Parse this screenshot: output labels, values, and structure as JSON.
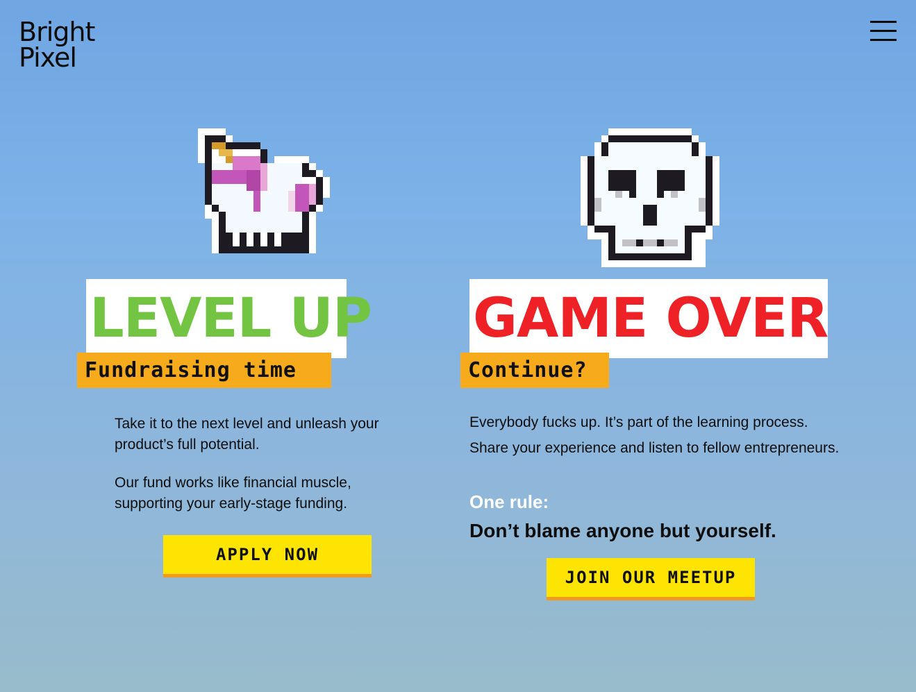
{
  "header": {
    "logo_line1": "Bright",
    "logo_line2": "Pixel",
    "menu_icon": "hamburger-menu-icon"
  },
  "left": {
    "sprite_icon": "pixel-unicorn-icon",
    "title": "LEVEL UP",
    "title_color": "#72c442",
    "subtitle": "Fundraising time",
    "paragraph1": "Take it to the next level and unleash your product’s full potential.",
    "paragraph2": "Our fund works like financial muscle, supporting your early-stage funding.",
    "button_label": "APPLY NOW"
  },
  "right": {
    "sprite_icon": "pixel-skull-icon",
    "title": "GAME OVER",
    "title_color": "#ee2226",
    "subtitle": "Continue?",
    "paragraph1": "Everybody fucks up. It’s part of the learning process. Share your experience and listen to fellow entrepreneurs.",
    "rule_label": "One rule:",
    "rule_text": "Don’t blame anyone but yourself.",
    "button_label": "JOIN OUR MEETUP"
  },
  "colors": {
    "subtitle_bg": "#f6ab1d",
    "button_bg": "#fde402",
    "button_shadow": "#f39a1b"
  }
}
